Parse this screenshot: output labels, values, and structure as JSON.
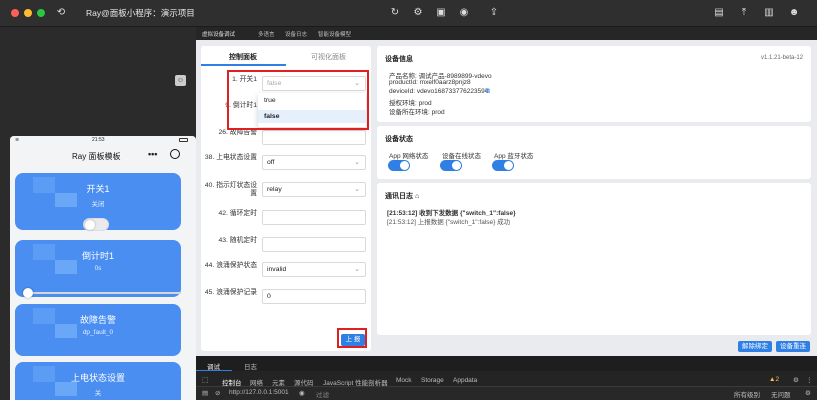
{
  "window": {
    "title": "Ray@面板小程序：演示项目",
    "toolbar_icons": [
      "refresh-icon",
      "debug-icon",
      "device-icon",
      "preview-icon",
      "upload-icon"
    ],
    "right_icons": [
      "terminal-icon",
      "export-icon",
      "delete-icon",
      "user-icon"
    ]
  },
  "colors": {
    "accent": "#2f7fe5",
    "highlight": "#e02020"
  },
  "editor_tabs": [
    "虚拟设备调试",
    "多语言",
    "设备日志",
    "智能设备模型"
  ],
  "phone": {
    "time": "21:53",
    "title": "Ray 面板模板",
    "cards": [
      {
        "title": "开关1",
        "sub": "关闭"
      },
      {
        "title": "倒计时1",
        "sub": "0s"
      },
      {
        "title": "故障告警",
        "sub": "dp_fault_0"
      },
      {
        "title": "上电状态设置",
        "sub": "关"
      }
    ]
  },
  "control": {
    "tab_active": "控制面板",
    "tab_other": "可视化面板",
    "rows": [
      {
        "label": "1. 开关1",
        "value": "false"
      },
      {
        "label": "9. 倒计时1",
        "value": ""
      },
      {
        "label": "26. 故障告警",
        "value": ""
      },
      {
        "label": "38. 上电状态设置",
        "value": "off"
      },
      {
        "label": "40. 指示灯状态设置",
        "value": "relay"
      },
      {
        "label": "42. 循环定时",
        "value": ""
      },
      {
        "label": "43. 随机定时",
        "value": ""
      },
      {
        "label": "44. 浪涌保护状态",
        "value": "invalid"
      },
      {
        "label": "45. 浪涌保护记录",
        "value": "0"
      }
    ],
    "options": [
      "true",
      "false"
    ],
    "report_button": "上 报"
  },
  "device_info": {
    "title": "设备信息",
    "version": "v1.1.21-beta-12",
    "lines": [
      "产品名称: 调试产品-8989899-vdevo",
      "productId: mxelf0aarz8pnjz8",
      "deviceId: vdevo168733776223594",
      "授权环境: prod",
      "设备所在环境: prod"
    ]
  },
  "device_status": {
    "title": "设备状态",
    "items": [
      "App 网络状态",
      "设备在线状态",
      "App 蓝牙状态"
    ]
  },
  "comm_log": {
    "title": "通讯日志",
    "lines": [
      "[21:53:12] 收到下发数据 {\"switch_1\":false}",
      "[21:53:12] 上报数据 {\"switch_1\":false} 成功"
    ]
  },
  "bottom_buttons": {
    "unbind": "解除绑定",
    "reset": "设备重连"
  },
  "devtools": {
    "tabs": [
      "调试",
      "日志"
    ],
    "panels": [
      "控制台",
      "网络",
      "元素",
      "源代码",
      "JavaScript 性能剖析器",
      "Mock",
      "Storage",
      "Appdata"
    ],
    "url": "http://127.0.0.1:5001",
    "filter": "过滤",
    "level": "所有级别",
    "issues": "无问题",
    "warn_count": "2"
  }
}
